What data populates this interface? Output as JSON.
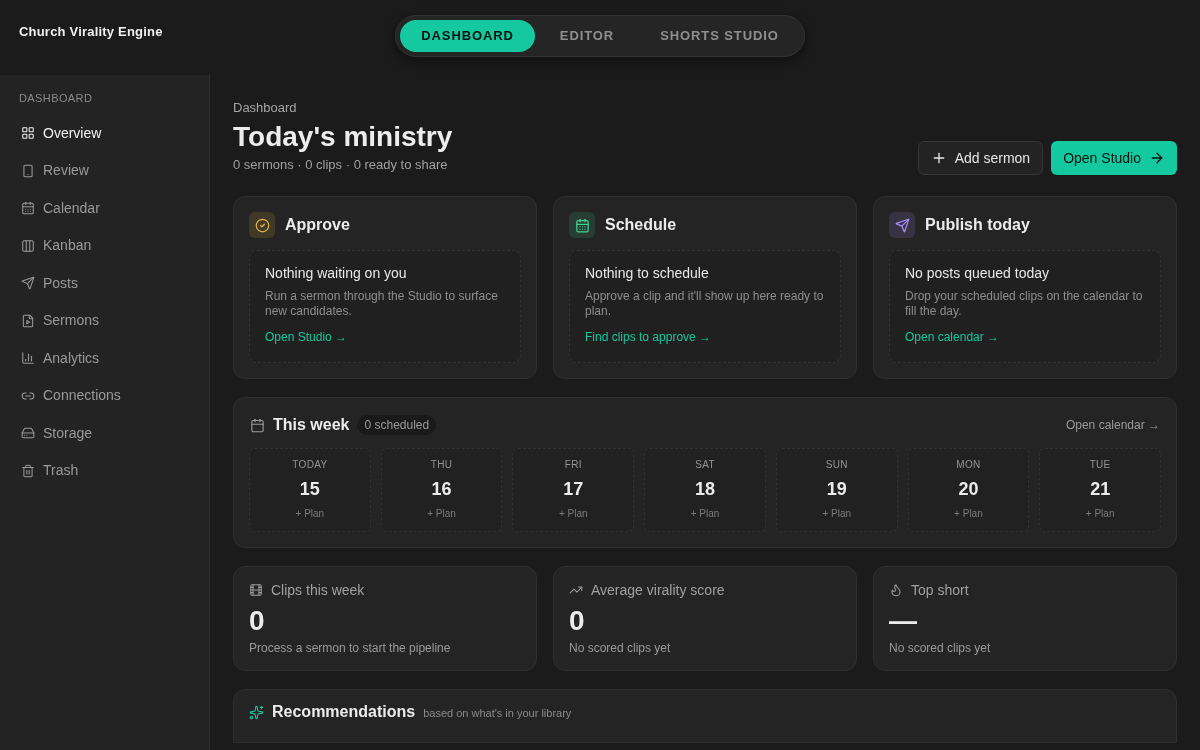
{
  "app": {
    "title": "Church Virality Engine"
  },
  "tabs": [
    {
      "label": "DASHBOARD",
      "selected": true
    },
    {
      "label": "EDITOR",
      "selected": false
    },
    {
      "label": "SHORTS STUDIO",
      "selected": false
    }
  ],
  "sidebar": {
    "section": "DASHBOARD",
    "items": [
      {
        "label": "Overview",
        "selected": true
      },
      {
        "label": "Review",
        "selected": false
      },
      {
        "label": "Calendar",
        "selected": false
      },
      {
        "label": "Kanban",
        "selected": false
      },
      {
        "label": "Posts",
        "selected": false
      },
      {
        "label": "Sermons",
        "selected": false
      },
      {
        "label": "Analytics",
        "selected": false
      },
      {
        "label": "Connections",
        "selected": false
      },
      {
        "label": "Storage",
        "selected": false
      },
      {
        "label": "Trash",
        "selected": false
      }
    ]
  },
  "page": {
    "breadcrumb": "Dashboard",
    "title": "Today's ministry",
    "subtitle": "0 sermons · 0 clips · 0 ready to share",
    "buttons": [
      {
        "label": "Add sermon",
        "kind": "secondary"
      },
      {
        "label": "Open Studio",
        "kind": "primary"
      }
    ]
  },
  "action_cards": [
    {
      "title": "Approve",
      "color": "#e3b341",
      "empty": {
        "title": "Nothing waiting on you",
        "text": "Run a sermon through the Studio to surface new candidates.",
        "link": "Open Studio →"
      }
    },
    {
      "title": "Schedule",
      "color": "#3fcf8e",
      "empty": {
        "title": "Nothing to schedule",
        "text": "Approve a clip and it'll show up here ready to plan.",
        "link": "Find clips to approve →"
      }
    },
    {
      "title": "Publish today",
      "color": "#a78bfa",
      "empty": {
        "title": "No posts queued today",
        "text": "Drop your scheduled clips on the calendar to fill the day.",
        "link": "Open calendar →"
      }
    }
  ],
  "week": {
    "title": "This week",
    "badge": "0 scheduled",
    "link": "Open calendar →",
    "days": [
      {
        "label": "TODAY",
        "date": "15",
        "action": "+ Plan"
      },
      {
        "label": "THU",
        "date": "16",
        "action": "+ Plan"
      },
      {
        "label": "FRI",
        "date": "17",
        "action": "+ Plan"
      },
      {
        "label": "SAT",
        "date": "18",
        "action": "+ Plan"
      },
      {
        "label": "SUN",
        "date": "19",
        "action": "+ Plan"
      },
      {
        "label": "MON",
        "date": "20",
        "action": "+ Plan"
      },
      {
        "label": "TUE",
        "date": "21",
        "action": "+ Plan"
      }
    ]
  },
  "stats": [
    {
      "label": "Clips this week",
      "value": "0",
      "note": "Process a sermon to start the pipeline"
    },
    {
      "label": "Average virality score",
      "value": "0",
      "note": "No scored clips yet"
    },
    {
      "label": "Top short",
      "value": "—",
      "note": "No scored clips yet"
    }
  ],
  "recommendations": {
    "title": "Recommendations",
    "subtitle": "based on what's in your library"
  }
}
